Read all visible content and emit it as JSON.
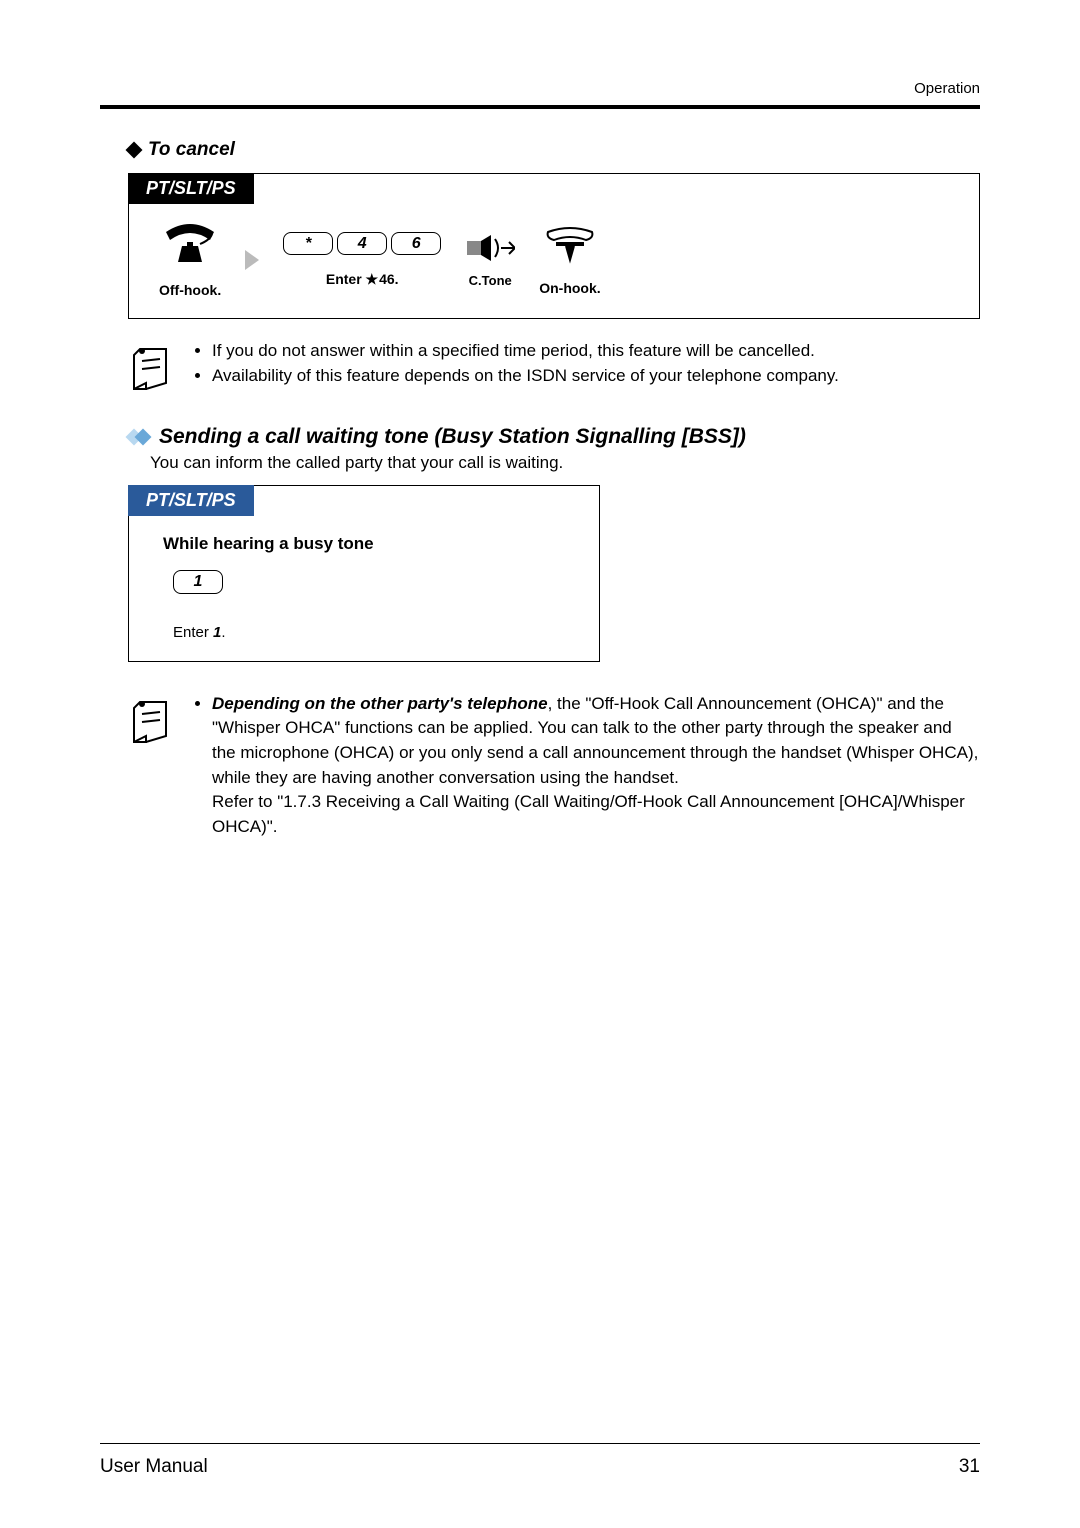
{
  "header": {
    "category": "Operation"
  },
  "cancel": {
    "heading": "To cancel",
    "tab": "PT/SLT/PS",
    "step_offhook": "Off-hook.",
    "keys": [
      "*",
      "4",
      "6"
    ],
    "step_enter": "Enter   46.",
    "step_enter_prefix": "Enter",
    "step_enter_star": "*",
    "step_enter_num": "46.",
    "step_ctone": "C.Tone",
    "step_onhook": "On-hook."
  },
  "notes1": {
    "item1": "If you do not answer within a specified time period, this feature will be cancelled.",
    "item2": "Availability of this feature depends on the ISDN service of your telephone company."
  },
  "bss": {
    "title": "Sending a call waiting tone (Busy Station Signalling [BSS])",
    "desc": "You can inform the called party that your call is waiting.",
    "tab": "PT/SLT/PS",
    "heading": "While hearing a busy tone",
    "key": "1",
    "enter_label_pre": "Enter ",
    "enter_label_key": "1",
    "enter_label_post": "."
  },
  "notes2": {
    "lead_bold": "Depending on the other party's telephone",
    "body": ", the \"Off-Hook Call Announcement (OHCA)\" and the \"Whisper OHCA\" functions can be applied. You can talk to the other party through the speaker and the microphone (OHCA) or you only send a call announcement through the handset (Whisper OHCA), while they are having another conversation using the handset.",
    "refer": "Refer to \"1.7.3   Receiving a Call Waiting (Call Waiting/Off-Hook Call Announcement [OHCA]/Whisper OHCA)\"."
  },
  "footer": {
    "left": "User Manual",
    "right": "31"
  }
}
